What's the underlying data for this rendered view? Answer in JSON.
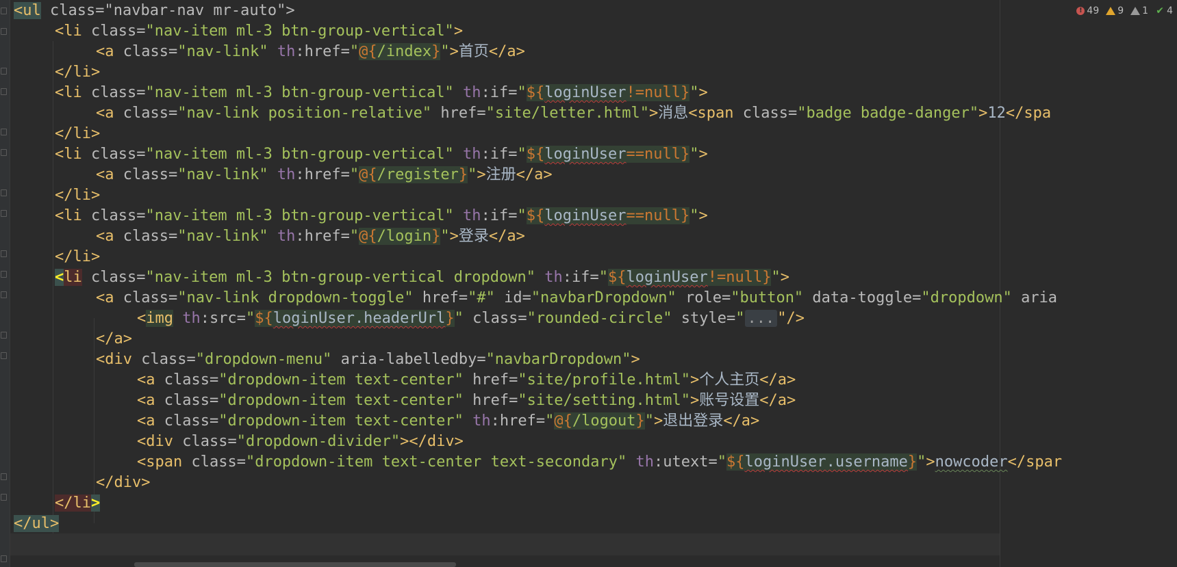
{
  "inspections": {
    "errors": "49",
    "warnings": "9",
    "weak_warnings": "1",
    "ok": "4"
  },
  "code": {
    "l1": [
      "<ul",
      " class=\"navbar-nav mr-auto\">"
    ],
    "l2": [
      "<li",
      " class=",
      "\"nav-item ml-3 btn-group-vertical\"",
      ">"
    ],
    "l3": [
      "<a",
      " class=",
      "\"nav-link\"",
      " th",
      ":href=",
      "\"",
      "@{",
      "/index",
      "}",
      "\"",
      ">",
      "首页",
      "</a>"
    ],
    "l4": [
      "</li>"
    ],
    "l5": [
      "<li",
      " class=",
      "\"nav-item ml-3 btn-group-vertical\"",
      " th",
      ":if=",
      "\"",
      "${",
      "loginUser",
      "!=null",
      "}",
      "\"",
      ">"
    ],
    "l6": [
      "<a",
      " class=",
      "\"nav-link position-relative\"",
      " href=",
      "\"site/letter.html\"",
      ">",
      "消息",
      "<span",
      " class=",
      "\"badge badge-danger\"",
      ">",
      "12",
      "</spa"
    ],
    "l7": [
      "</li>"
    ],
    "l8": [
      "<li",
      " class=",
      "\"nav-item ml-3 btn-group-vertical\"",
      " th",
      ":if=",
      "\"",
      "${",
      "loginUser",
      "==null",
      "}",
      "\"",
      ">"
    ],
    "l9": [
      "<a",
      " class=",
      "\"nav-link\"",
      " th",
      ":href=",
      "\"",
      "@{",
      "/register",
      "}",
      "\"",
      ">",
      "注册",
      "</a>"
    ],
    "l10": [
      "</li>"
    ],
    "l11": [
      "<li",
      " class=",
      "\"nav-item ml-3 btn-group-vertical\"",
      " th",
      ":if=",
      "\"",
      "${",
      "loginUser",
      "==null",
      "}",
      "\"",
      ">"
    ],
    "l12": [
      "<a",
      " class=",
      "\"nav-link\"",
      " th",
      ":href=",
      "\"",
      "@{",
      "/login",
      "}",
      "\"",
      ">",
      "登录",
      "</a>"
    ],
    "l13": [
      "</li>"
    ],
    "l14": [
      "<",
      "li",
      " class=",
      "\"nav-item ml-3 btn-group-vertical dropdown\"",
      " th",
      ":if=",
      "\"",
      "${",
      "loginUser",
      "!=null",
      "}",
      "\"",
      ">"
    ],
    "l15": [
      "<a",
      " class=",
      "\"nav-link dropdown-toggle\"",
      " href=",
      "\"#\"",
      " id=",
      "\"navbarDropdown\"",
      " role=",
      "\"button\"",
      " data-toggle=",
      "\"dropdown\"",
      " aria"
    ],
    "l16": [
      "<",
      "img",
      " th",
      ":src=",
      "\"",
      "${",
      "loginUser.headerUrl",
      "}",
      "\"",
      " class=",
      "\"rounded-circle\"",
      " style=",
      "\"",
      "...",
      "\"/>"
    ],
    "l17": [
      "</a>"
    ],
    "l18": [
      "<div",
      " class=",
      "\"dropdown-menu\"",
      " aria-labelledby=",
      "\"navbarDropdown\"",
      ">"
    ],
    "l19": [
      "<a",
      " class=",
      "\"dropdown-item text-center\"",
      " href=",
      "\"site/profile.html\"",
      ">",
      "个人主页",
      "</a>"
    ],
    "l20": [
      "<a",
      " class=",
      "\"dropdown-item text-center\"",
      " href=",
      "\"site/setting.html\"",
      ">",
      "账号设置",
      "</a>"
    ],
    "l21": [
      "<a",
      " class=",
      "\"dropdown-item text-center\"",
      " th",
      ":href=",
      "\"",
      "@{",
      "/logout",
      "}",
      "\"",
      ">",
      "退出登录",
      "</a>"
    ],
    "l22": [
      "<div",
      " class=",
      "\"dropdown-divider\"",
      "></div>"
    ],
    "l23": [
      "<span",
      " class=",
      "\"dropdown-item text-center text-secondary\"",
      " th",
      ":utext=",
      "\"",
      "${",
      "loginUser.username",
      "}",
      "\"",
      ">",
      "nowcoder",
      "</spar"
    ],
    "l24": [
      "</div>"
    ],
    "l25": [
      "</li",
      ">"
    ],
    "l26": [
      "</ul>"
    ]
  }
}
